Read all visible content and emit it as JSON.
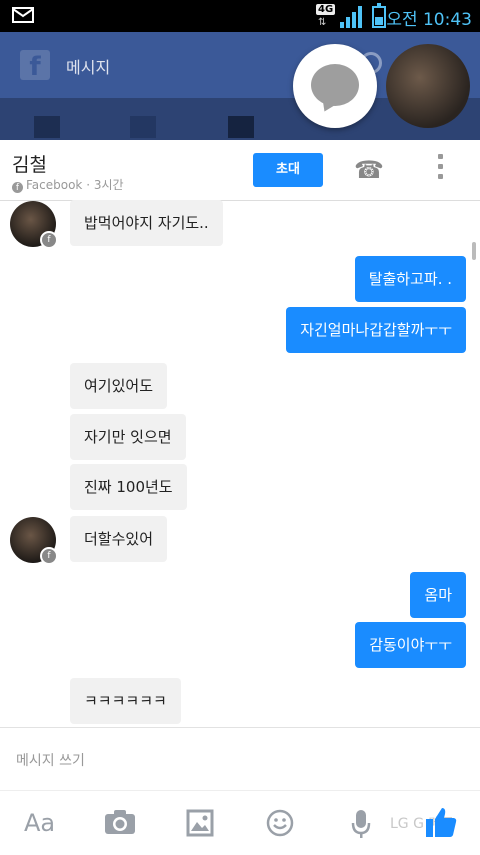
{
  "status": {
    "network": "4G",
    "time": "오전 10:43",
    "colors": {
      "accent": "#4fc3f7"
    }
  },
  "fb": {
    "title": "메시지"
  },
  "chat": {
    "name": "김철",
    "sub": "Facebook · 3시간",
    "invite": "초대",
    "messages": [
      {
        "dir": "in",
        "text": "밥먹어야지 자기도..",
        "avatar": true
      },
      {
        "dir": "out",
        "text": "탈출하고파. ."
      },
      {
        "dir": "out",
        "text": "자긴얼마나갑갑할까ㅜㅜ"
      },
      {
        "dir": "in",
        "text": "여기있어도"
      },
      {
        "dir": "in",
        "text": "자기만 잇으면"
      },
      {
        "dir": "in",
        "text": "진짜 100년도"
      },
      {
        "dir": "in",
        "text": "더할수있어",
        "avatar": true
      },
      {
        "dir": "out",
        "text": "옴마"
      },
      {
        "dir": "out",
        "text": "감동이야ㅜㅜ"
      },
      {
        "dir": "in",
        "text": "ㅋㅋㅋㅋㅋㅋ"
      }
    ]
  },
  "composer": {
    "placeholder": "메시지 쓰기"
  },
  "toolbar": {
    "text_label": "Aa",
    "watermark": "LG G 메모"
  },
  "colors": {
    "brand_fb": "#3b5998",
    "bubble_out": "#1a8cff",
    "bubble_in": "#f1f1f1"
  }
}
